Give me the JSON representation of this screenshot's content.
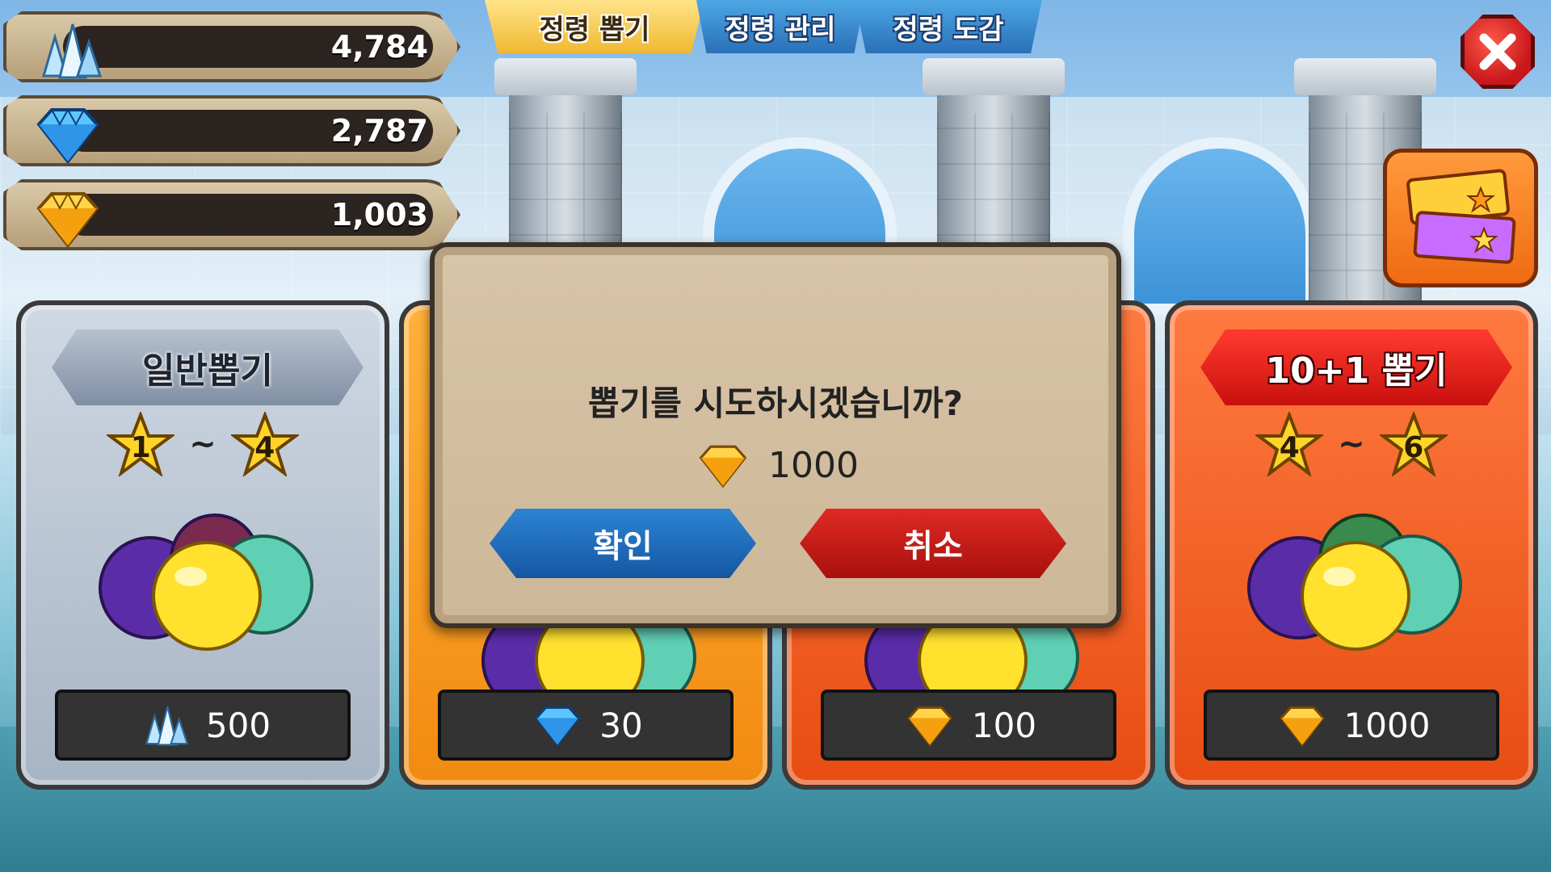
{
  "currencies": [
    {
      "name": "crystal",
      "icon": "crystal-icon",
      "value": "4,784"
    },
    {
      "name": "blue-gem",
      "icon": "blue-diamond-icon",
      "value": "2,787"
    },
    {
      "name": "gold-gem",
      "icon": "gold-diamond-icon",
      "value": "1,003"
    }
  ],
  "tabs": [
    {
      "label": "정령 뽑기",
      "active": true
    },
    {
      "label": "정령 관리",
      "active": false
    },
    {
      "label": "정령 도감",
      "active": false
    }
  ],
  "cards": [
    {
      "title": "일반뽑기",
      "star_min": "1",
      "star_max": "4",
      "price": "500",
      "price_icon": "crystal-icon",
      "theme": "silver"
    },
    {
      "title": "",
      "star_min": "",
      "star_max": "",
      "price": "30",
      "price_icon": "blue-diamond-icon",
      "theme": "orange"
    },
    {
      "title": "",
      "star_min": "",
      "star_max": "",
      "price": "100",
      "price_icon": "gold-diamond-icon",
      "theme": "red"
    },
    {
      "title": "10+1 뽑기",
      "star_min": "4",
      "star_max": "6",
      "price": "1000",
      "price_icon": "gold-diamond-icon",
      "theme": "red"
    }
  ],
  "dialog": {
    "message": "뽑기를 시도하시겠습니까?",
    "cost": "1000",
    "cost_icon": "gold-diamond-icon",
    "confirm_label": "확인",
    "cancel_label": "취소"
  },
  "tilde": "~",
  "colors": {
    "accent_gold": "#f0b830",
    "tab_blue": "#2a70b8",
    "confirm_blue": "#1457a3",
    "cancel_red": "#a8100d",
    "card_orange": "#f28a10",
    "card_red": "#e74d12"
  }
}
